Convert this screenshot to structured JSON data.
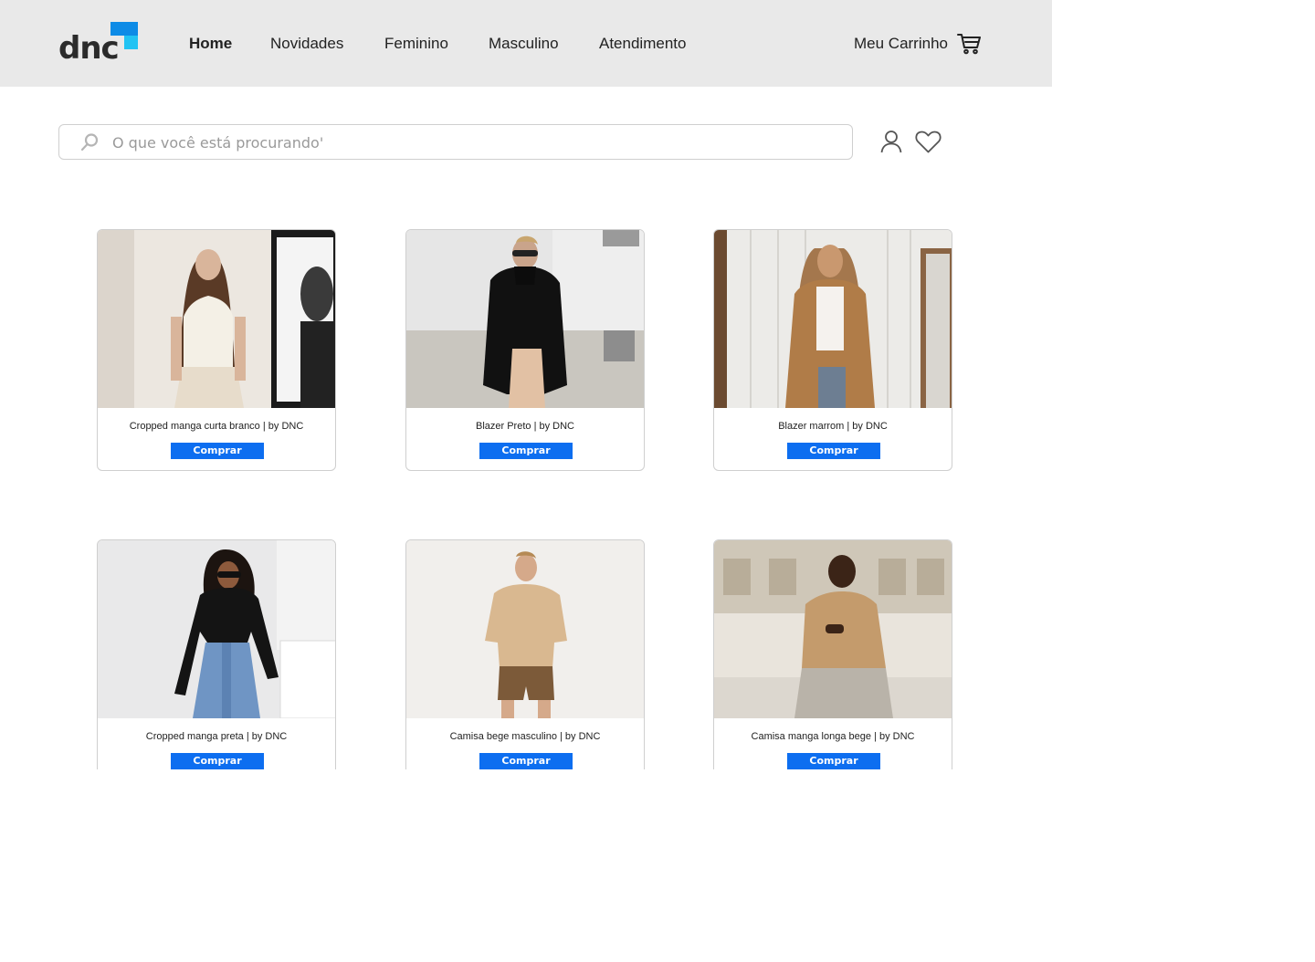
{
  "brand": {
    "logo_text": "dnc",
    "colors": {
      "accent_dark": "#0d8be6",
      "accent_light": "#22c3f3"
    }
  },
  "nav": {
    "items": [
      {
        "label": "Home",
        "active": true
      },
      {
        "label": "Novidades",
        "active": false
      },
      {
        "label": "Feminino",
        "active": false
      },
      {
        "label": "Masculino",
        "active": false
      },
      {
        "label": "Atendimento",
        "active": false
      }
    ]
  },
  "cart": {
    "label": "Meu Carrinho",
    "icon": "cart-icon"
  },
  "search": {
    "placeholder": "O que você está procurando'",
    "value": "",
    "icon": "search-icon"
  },
  "account": {
    "user_icon": "user-icon",
    "wishlist_icon": "heart-icon"
  },
  "products": [
    {
      "title": "Cropped manga curta branco | by DNC",
      "button": "Comprar"
    },
    {
      "title": "Blazer Preto | by DNC",
      "button": "Comprar"
    },
    {
      "title": "Blazer marrom | by DNC",
      "button": "Comprar"
    },
    {
      "title": "Cropped manga preta | by DNC",
      "button": "Comprar"
    },
    {
      "title": "Camisa bege masculino | by DNC",
      "button": "Comprar"
    },
    {
      "title": "Camisa manga longa bege | by DNC",
      "button": "Comprar"
    }
  ],
  "colors": {
    "button": "#0d6ef0",
    "header_bg": "#e9e9e9"
  }
}
